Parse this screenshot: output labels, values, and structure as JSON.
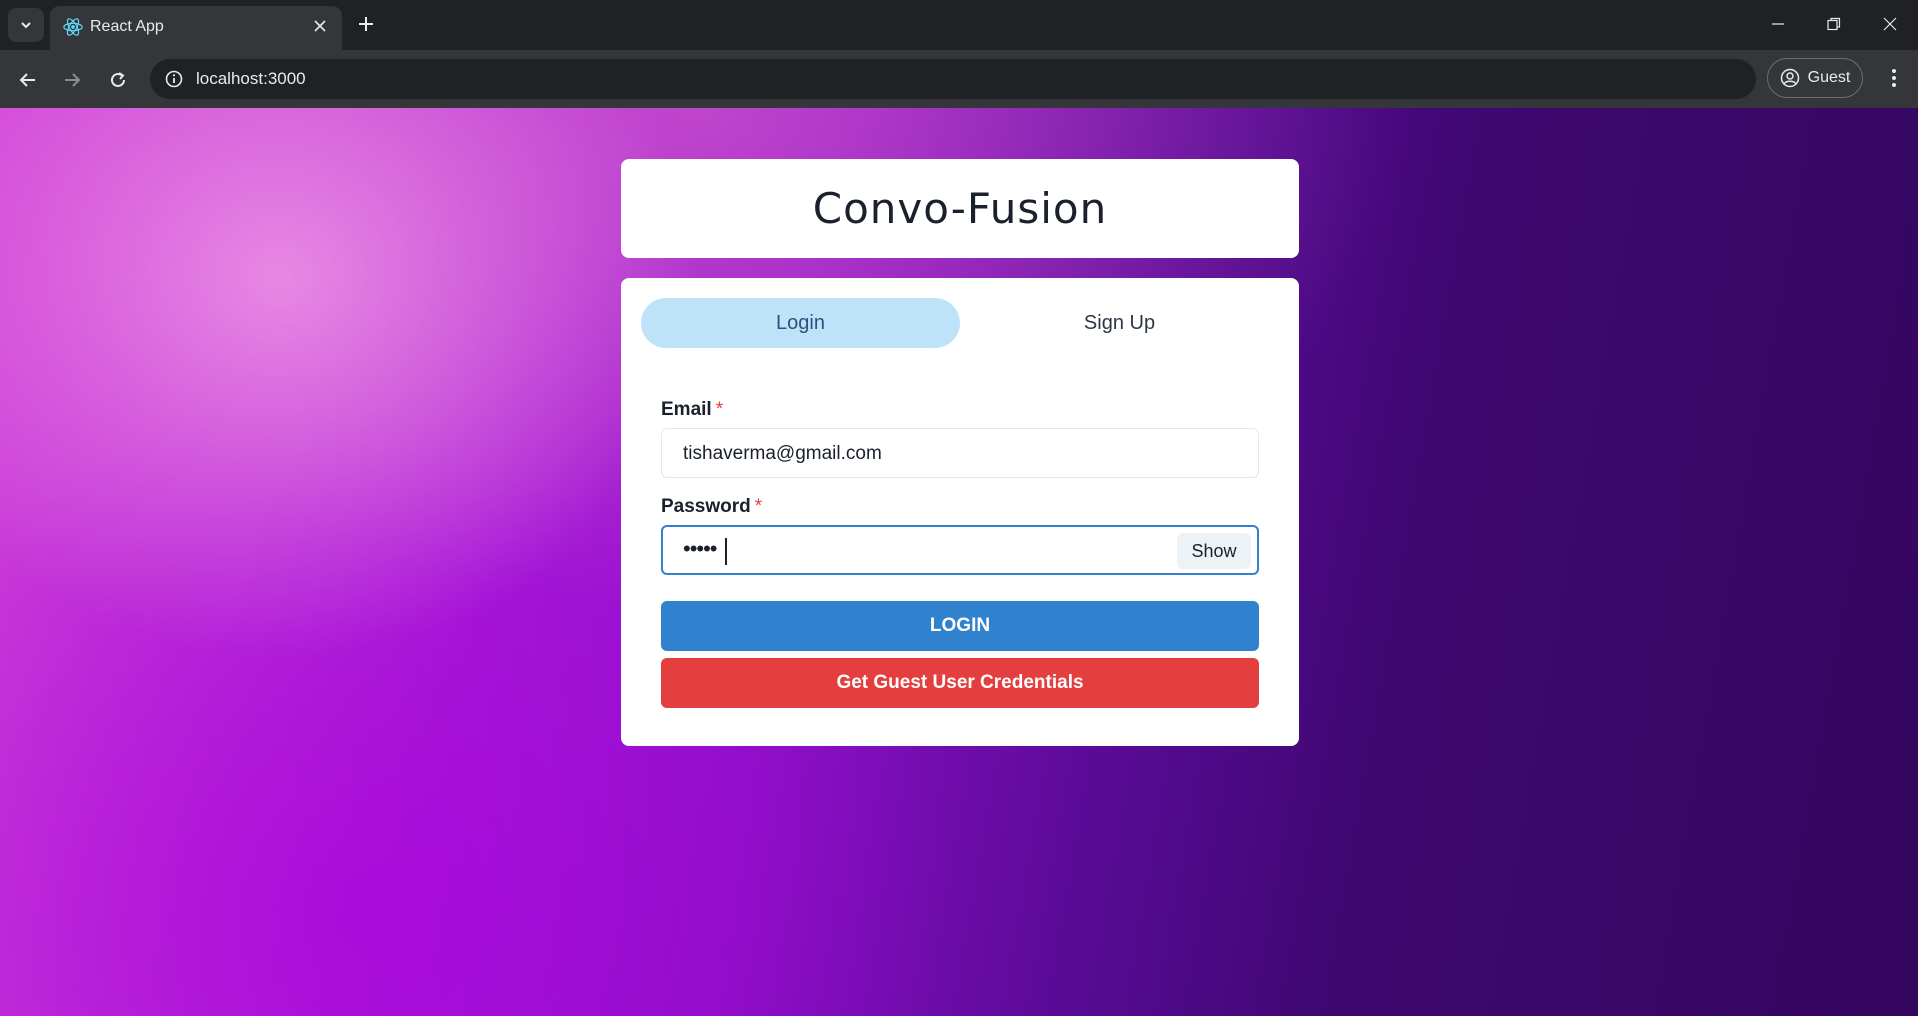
{
  "browser": {
    "tab_title": "React App",
    "url": "localhost:3000",
    "profile_label": "Guest"
  },
  "app": {
    "title": "Convo-Fusion"
  },
  "auth_tabs": {
    "login_label": "Login",
    "signup_label": "Sign Up",
    "active": "Login"
  },
  "form": {
    "email_label": "Email",
    "email_value": "tishaverma@gmail.com",
    "password_label": "Password",
    "password_masked": "•••••",
    "required_marker": "*",
    "show_label": "Show",
    "login_button": "LOGIN",
    "guest_button": "Get Guest User Credentials"
  },
  "colors": {
    "primary": "#3182ce",
    "danger": "#e53e3e",
    "active_tab": "#bee3f8"
  }
}
